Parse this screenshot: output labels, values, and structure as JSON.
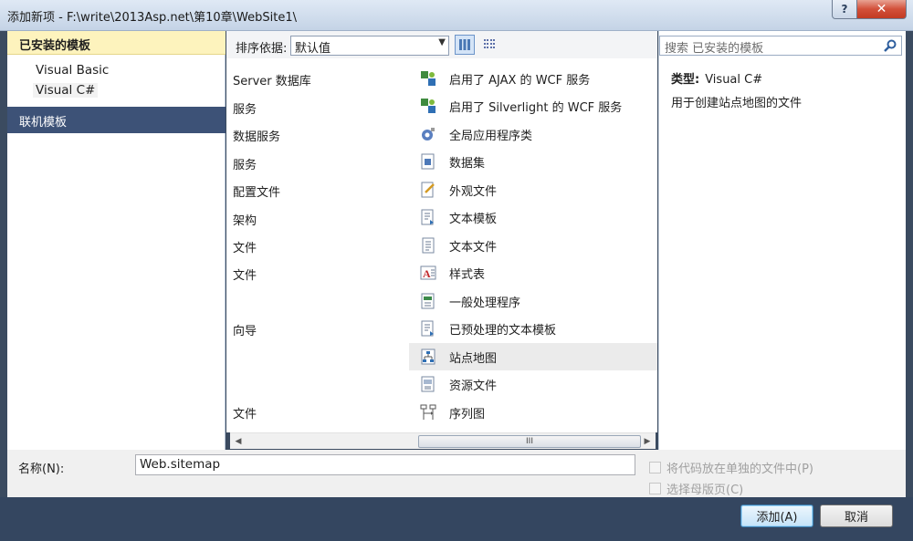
{
  "window": {
    "title": "添加新项 - F:\\write\\2013Asp.net\\第10章\\WebSite1\\",
    "help_label": "?",
    "close_label": "✕"
  },
  "left": {
    "header": "已安装的模板",
    "items": [
      "Visual Basic",
      "Visual C#"
    ],
    "online": "联机模板"
  },
  "toolbar": {
    "sort_label": "排序依据:",
    "sort_value": "默认值"
  },
  "list": {
    "col1": [
      "Server 数据库",
      "服务",
      "数据服务",
      "服务",
      "配置文件",
      "架构",
      "文件",
      "文件",
      "",
      "向导",
      "",
      "",
      "文件"
    ],
    "col2": [
      {
        "label": "启用了 AJAX 的 WCF 服务",
        "icon": "wcf-icon"
      },
      {
        "label": "启用了 Silverlight 的 WCF 服务",
        "icon": "wcf-icon"
      },
      {
        "label": "全局应用程序类",
        "icon": "global-class-icon"
      },
      {
        "label": "数据集",
        "icon": "dataset-icon"
      },
      {
        "label": "外观文件",
        "icon": "skin-file-icon"
      },
      {
        "label": "文本模板",
        "icon": "text-template-icon"
      },
      {
        "label": "文本文件",
        "icon": "text-file-icon"
      },
      {
        "label": "样式表",
        "icon": "stylesheet-icon"
      },
      {
        "label": "一般处理程序",
        "icon": "handler-icon"
      },
      {
        "label": "已预处理的文本模板",
        "icon": "text-template-icon"
      },
      {
        "label": "站点地图",
        "icon": "sitemap-icon",
        "selected": true
      },
      {
        "label": "资源文件",
        "icon": "resource-file-icon"
      },
      {
        "label": "序列图",
        "icon": "sequence-diagram-icon"
      }
    ],
    "scroll_thumb_label": "III"
  },
  "right": {
    "search_placeholder": "搜索 已安装的模板",
    "type_label": "类型:",
    "type_value": "Visual C#",
    "description": "用于创建站点地图的文件"
  },
  "bottom": {
    "name_label": "名称(N):",
    "name_value": "Web.sitemap",
    "check1": "将代码放在单独的文件中(P)",
    "check2": "选择母版页(C)"
  },
  "buttons": {
    "add": "添加(A)",
    "cancel": "取消"
  },
  "colors": {
    "header_yellow": "#fdf3bd",
    "online_navy": "#3d5277",
    "footer_band": "#344660"
  }
}
